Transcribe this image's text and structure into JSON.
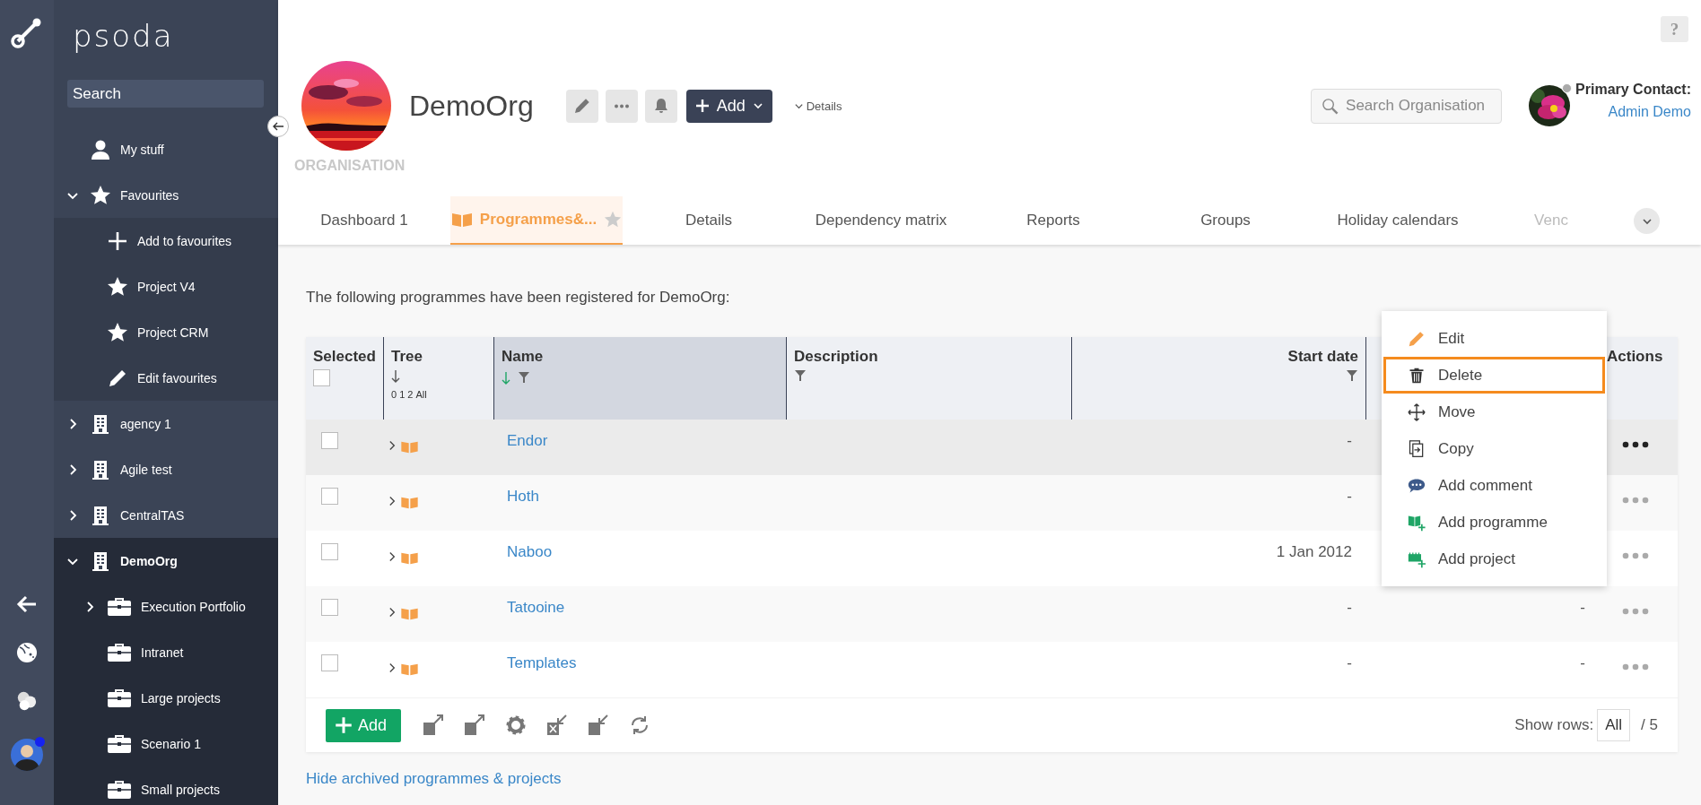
{
  "sidebar": {
    "brand": "psoda",
    "search": {
      "placeholder": "Search"
    },
    "items": [
      {
        "label": "My stuff",
        "kind": "user",
        "selected": false
      },
      {
        "label": "Favourites",
        "kind": "favourites",
        "selected": false,
        "expanded": true,
        "children": [
          {
            "label": "Add to favourites",
            "kind": "add",
            "selected": false
          },
          {
            "label": "Project V4",
            "kind": "favourite",
            "selected": false
          },
          {
            "label": "Project CRM",
            "kind": "favourite",
            "selected": false
          },
          {
            "label": "Edit favourites",
            "kind": "edit",
            "selected": false
          }
        ]
      },
      {
        "label": "agency 1",
        "kind": "organisation",
        "selected": false,
        "expanded": false
      },
      {
        "label": "Agile test",
        "kind": "organisation",
        "selected": false,
        "expanded": false
      },
      {
        "label": "CentralTAS",
        "kind": "organisation",
        "selected": false,
        "expanded": false
      },
      {
        "label": "DemoOrg",
        "kind": "organisation",
        "selected": true,
        "expanded": true,
        "children": [
          {
            "label": "Execution Portfolio",
            "kind": "portfolio",
            "selected": false,
            "expanded": false
          },
          {
            "label": "Intranet",
            "kind": "portfolio",
            "selected": false
          },
          {
            "label": "Large projects",
            "kind": "portfolio",
            "selected": false
          },
          {
            "label": "Scenario 1",
            "kind": "portfolio",
            "selected": false
          },
          {
            "label": "Small projects",
            "kind": "portfolio",
            "selected": false
          }
        ]
      }
    ]
  },
  "help": "?",
  "organisation": {
    "name": "DemoOrg",
    "type": "ORGANISATION",
    "add_button": "Add",
    "details_link": "Details",
    "search": {
      "placeholder": "Search Organisation"
    },
    "contact": {
      "label": "Primary Contact:",
      "name": "Admin Demo"
    }
  },
  "tabs": [
    {
      "label": "Dashboard 1",
      "selected": false
    },
    {
      "label": "Programmes&...",
      "selected": true
    },
    {
      "label": "Details",
      "selected": false
    },
    {
      "label": "Dependency matrix",
      "selected": false
    },
    {
      "label": "Reports",
      "selected": false
    },
    {
      "label": "Groups",
      "selected": false
    },
    {
      "label": "Holiday calendars",
      "selected": false
    },
    {
      "label": "Venc",
      "selected": false
    }
  ],
  "intro": "The following programmes have been registered for DemoOrg:",
  "table": {
    "select_all": {
      "checked": false
    },
    "columns": [
      {
        "label": "Selected",
        "kind": "select"
      },
      {
        "label": "Tree",
        "kind": "tree",
        "sorted": false,
        "levels": [
          "0",
          "1",
          "2",
          "All"
        ]
      },
      {
        "label": "Name",
        "kind": "name",
        "sorted": true,
        "filter": true
      },
      {
        "label": "Description",
        "kind": "text",
        "filter": true
      },
      {
        "label": "Start date",
        "kind": "date",
        "filter": true
      },
      {
        "kind": "hidden"
      },
      {
        "label": "Actions",
        "kind": "actions"
      }
    ],
    "rows": [
      {
        "selected": false,
        "hovered": true,
        "name": "Endor",
        "start_date": "-"
      },
      {
        "selected": false,
        "hovered": false,
        "name": "Hoth",
        "start_date": "-"
      },
      {
        "selected": false,
        "hovered": false,
        "name": "Naboo",
        "start_date": "1 Jan 2012"
      },
      {
        "selected": false,
        "hovered": false,
        "name": "Tatooine",
        "start_date": "-",
        "column_6": "-"
      },
      {
        "selected": false,
        "hovered": false,
        "name": "Templates",
        "start_date": "-",
        "column_6": "-"
      }
    ]
  },
  "footer": {
    "add_button": "Add",
    "show_rows_label": "Show rows:",
    "show_rows": "All",
    "total": "/ 5"
  },
  "archive_link": "Hide archived programmes & projects",
  "context_menu": {
    "items": [
      {
        "label": "Edit",
        "kind": "edit",
        "selected": false
      },
      {
        "label": "Delete",
        "kind": "delete",
        "selected": true
      },
      {
        "label": "Move",
        "kind": "move",
        "selected": false
      },
      {
        "label": "Copy",
        "kind": "copy",
        "selected": false
      },
      {
        "label": "Add comment",
        "kind": "comment",
        "selected": false
      },
      {
        "label": "Add programme",
        "kind": "add-programme",
        "selected": false
      },
      {
        "label": "Add project",
        "kind": "add-project",
        "selected": false
      }
    ]
  }
}
